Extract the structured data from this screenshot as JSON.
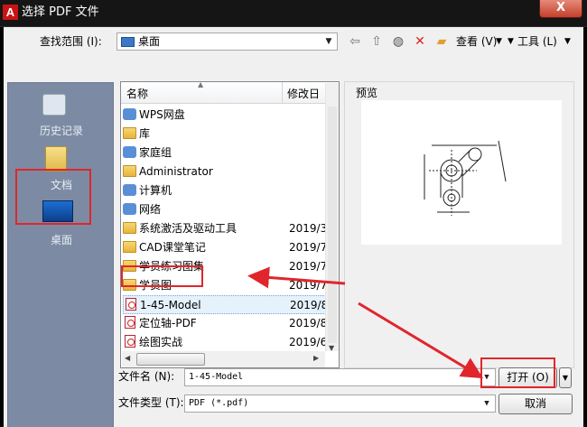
{
  "window": {
    "title": "选择 PDF 文件",
    "close_label": "X"
  },
  "lookin": {
    "label": "查找范围 (I):",
    "value": "桌面"
  },
  "toolbar": {
    "view_label": "查看 (V)",
    "tools_label": "工具 (L)"
  },
  "places": [
    {
      "label": "历史记录",
      "icon": "history-icon"
    },
    {
      "label": "文档",
      "icon": "documents-icon"
    },
    {
      "label": "桌面",
      "icon": "desktop-icon",
      "selected": true
    }
  ],
  "filelist": {
    "columns": [
      "名称",
      "修改日"
    ],
    "rows": [
      {
        "name": "WPS网盘",
        "date": "",
        "icon": "cloud-icon"
      },
      {
        "name": "库",
        "date": "",
        "icon": "library-icon"
      },
      {
        "name": "家庭组",
        "date": "",
        "icon": "homegroup-icon"
      },
      {
        "name": "Administrator",
        "date": "",
        "icon": "user-folder-icon"
      },
      {
        "name": "计算机",
        "date": "",
        "icon": "computer-icon"
      },
      {
        "name": "网络",
        "date": "",
        "icon": "network-icon"
      },
      {
        "name": "系统激活及驱动工具",
        "date": "2019/3",
        "icon": "folder-icon"
      },
      {
        "name": "CAD课堂笔记",
        "date": "2019/7",
        "icon": "folder-icon"
      },
      {
        "name": "学员练习图集",
        "date": "2019/7",
        "icon": "folder-icon"
      },
      {
        "name": "学员图",
        "date": "2019/7",
        "icon": "folder-icon"
      },
      {
        "name": "1-45-Model",
        "date": "2019/8",
        "icon": "pdf-icon",
        "selected": true
      },
      {
        "name": "定位轴-PDF",
        "date": "2019/8",
        "icon": "pdf-icon"
      },
      {
        "name": "绘图实战",
        "date": "2019/6",
        "icon": "pdf-icon"
      }
    ]
  },
  "preview": {
    "label": "预览"
  },
  "filename": {
    "label": "文件名 (N):",
    "value": "1-45-Model"
  },
  "filetype": {
    "label": "文件类型 (T):",
    "value": "PDF (*.pdf)"
  },
  "buttons": {
    "open": "打开 (O)",
    "cancel": "取消"
  }
}
